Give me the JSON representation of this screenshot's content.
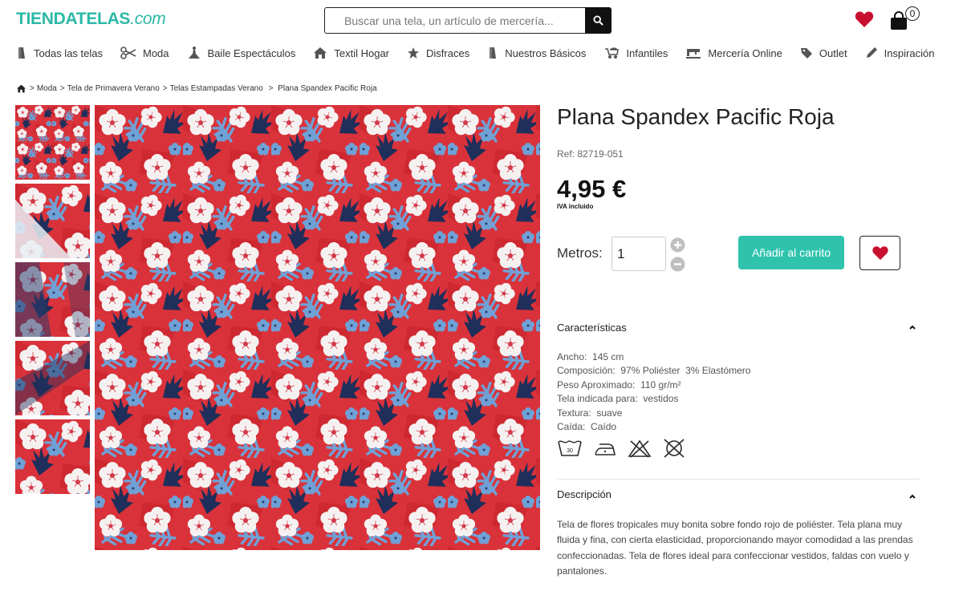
{
  "header": {
    "logo_main": "TIENDATELAS",
    "logo_suffix": ".com",
    "search_placeholder": "Buscar una tela, un artículo de mercería...",
    "cart_count": "0"
  },
  "nav": {
    "items": [
      {
        "label": "Todas las telas",
        "icon": "fabric-roll-icon"
      },
      {
        "label": "Moda",
        "icon": "scissors-icon"
      },
      {
        "label": "Baile Espectáculos",
        "icon": "dancer-icon"
      },
      {
        "label": "Textil Hogar",
        "icon": "home-icon"
      },
      {
        "label": "Disfraces",
        "icon": "star-icon"
      },
      {
        "label": "Nuestros Básicos",
        "icon": "fabric-roll-icon"
      },
      {
        "label": "Infantiles",
        "icon": "stroller-icon"
      },
      {
        "label": "Mercería Online",
        "icon": "sewing-machine-icon"
      },
      {
        "label": "Outlet",
        "icon": "tag-icon"
      },
      {
        "label": "Inspiración",
        "icon": "pencil-icon"
      }
    ]
  },
  "breadcrumb": {
    "items": [
      "Moda",
      "Tela de Primavera Verano",
      "Telas Estampadas Verano",
      "Plana Spandex Pacific Roja"
    ]
  },
  "product": {
    "title": "Plana Spandex Pacific Roja",
    "ref": "Ref: 82719-051",
    "price": "4,95 €",
    "vat": "IVA incluido",
    "qty_label": "Metros:",
    "qty_value": "1",
    "add_to_cart": "Añadir al carrito"
  },
  "characteristics": {
    "title": "Características",
    "rows": [
      {
        "label": "Ancho:",
        "value": "145 cm"
      },
      {
        "label": "Composición:",
        "value": "97% Poliéster  3% Elastómero"
      },
      {
        "label": "Peso Aproximado:",
        "value": "110 gr/m²"
      },
      {
        "label": "Tela indicada para:",
        "value": "vestidos"
      },
      {
        "label": "Textura:",
        "value": "suave"
      },
      {
        "label": "Caída:",
        "value": "Caído"
      }
    ],
    "care_icons": [
      "wash-30-icon",
      "iron-low-icon",
      "no-bleach-icon",
      "no-tumble-dry-icon"
    ],
    "wash_temp": "30"
  },
  "description": {
    "title": "Descripción",
    "text": "Tela de flores tropicales muy bonita sobre fondo rojo de poliéster. Tela plana muy fluida y fina, con cierta elasticidad, proporcionando mayor comodidad a las prendas confeccionadas. Tela de flores ideal para confeccionar vestidos, faldas con vuelo y pantalones."
  },
  "colors": {
    "brand": "#2bb8a6",
    "button": "#2fc3ad",
    "heart": "#c8102e",
    "fabric_red": "#d9323a",
    "fabric_navy": "#1f2e5a",
    "fabric_blue": "#6fa1d6",
    "fabric_white": "#f5f0f0"
  }
}
